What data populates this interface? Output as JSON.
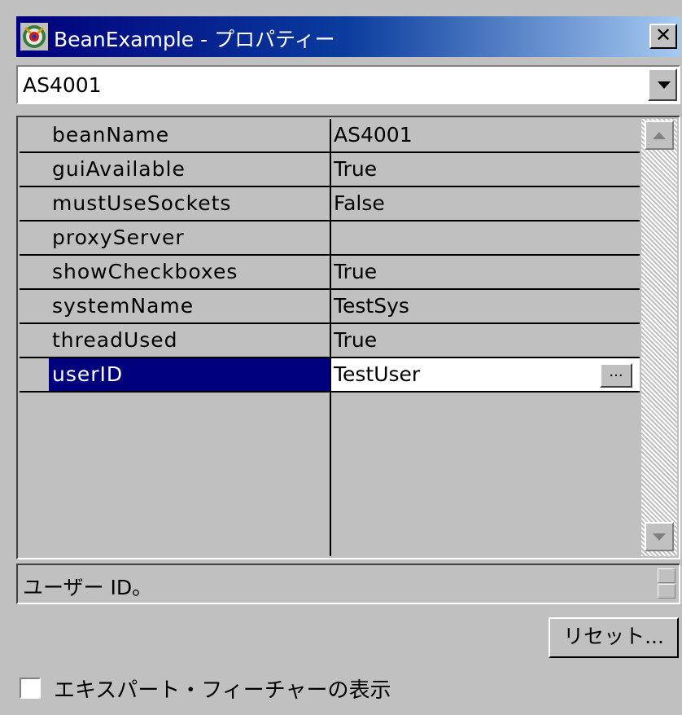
{
  "window": {
    "title": "BeanExample - プロパティー",
    "close_label": "✕"
  },
  "combo": {
    "selected": "AS4001"
  },
  "properties": [
    {
      "name": "beanName",
      "value": "AS4001"
    },
    {
      "name": "guiAvailable",
      "value": "True"
    },
    {
      "name": "mustUseSockets",
      "value": "False"
    },
    {
      "name": "proxyServer",
      "value": ""
    },
    {
      "name": "showCheckboxes",
      "value": "True"
    },
    {
      "name": "systemName",
      "value": "TestSys"
    },
    {
      "name": "threadUsed",
      "value": "True"
    },
    {
      "name": "userID",
      "value": "TestUser"
    }
  ],
  "selected_property": "userID",
  "ellipsis_label": "...",
  "description": "ユーザー ID。",
  "reset_label": "リセット...",
  "expert_checkbox": {
    "label": "エキスパート・フィーチャーの表示",
    "checked": false
  },
  "colors": {
    "title_gradient_start": "#00007c",
    "title_gradient_end": "#a6caf0",
    "selection": "#00007c",
    "face": "#c0c0c0"
  },
  "icons": [
    "bean-app-icon",
    "close-icon",
    "dropdown-arrow-icon",
    "scroll-up-icon",
    "scroll-down-icon",
    "spinner-icon"
  ]
}
